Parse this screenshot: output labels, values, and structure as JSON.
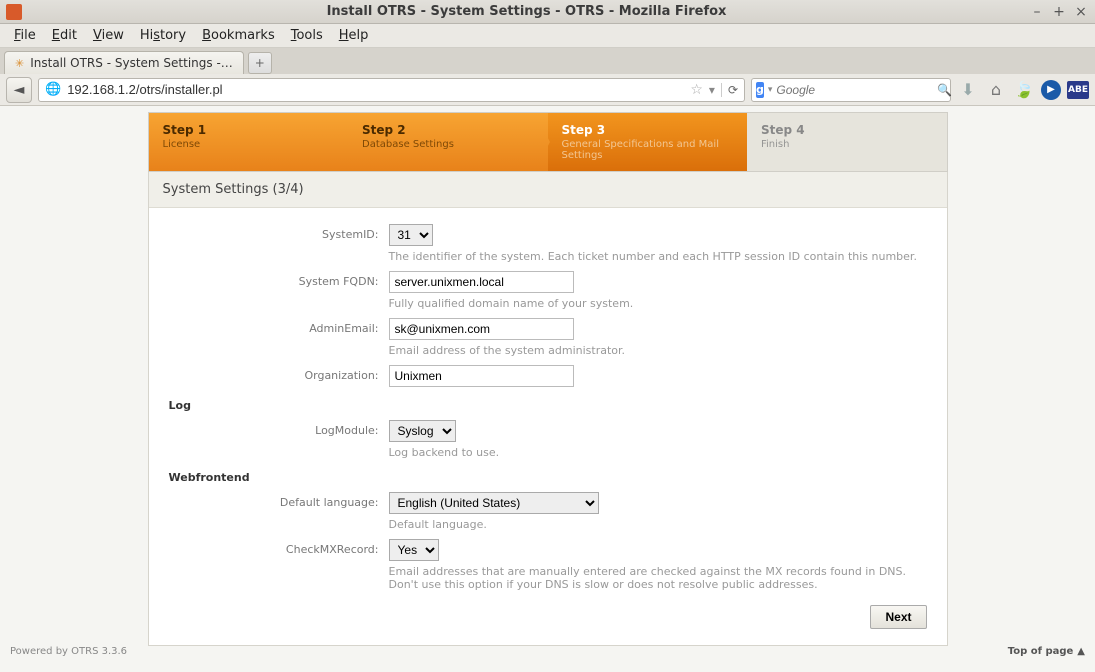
{
  "window": {
    "title": "Install OTRS - System Settings - OTRS - Mozilla Firefox"
  },
  "menu": {
    "file": "File",
    "edit": "Edit",
    "view": "View",
    "history": "History",
    "bookmarks": "Bookmarks",
    "tools": "Tools",
    "help": "Help"
  },
  "tab": {
    "label": "Install OTRS - System Settings -…"
  },
  "url": "192.168.1.2/otrs/installer.pl",
  "search": {
    "placeholder": "Google"
  },
  "steps": [
    {
      "title": "Step 1",
      "sub": "License"
    },
    {
      "title": "Step 2",
      "sub": "Database Settings"
    },
    {
      "title": "Step 3",
      "sub": "General Specifications and Mail Settings"
    },
    {
      "title": "Step 4",
      "sub": "Finish"
    }
  ],
  "panel": {
    "title": "System Settings (3/4)"
  },
  "fields": {
    "systemid": {
      "label": "SystemID:",
      "value": "31",
      "hint": "The identifier of the system. Each ticket number and each HTTP session ID contain this number."
    },
    "fqdn": {
      "label": "System FQDN:",
      "value": "server.unixmen.local",
      "hint": "Fully qualified domain name of your system."
    },
    "admin": {
      "label": "AdminEmail:",
      "value": "sk@unixmen.com",
      "hint": "Email address of the system administrator."
    },
    "org": {
      "label": "Organization:",
      "value": "Unixmen"
    },
    "logmodule": {
      "label": "LogModule:",
      "value": "Syslog",
      "hint": "Log backend to use."
    },
    "lang": {
      "label": "Default language:",
      "value": "English (United States)",
      "hint": "Default language."
    },
    "mx": {
      "label": "CheckMXRecord:",
      "value": "Yes",
      "hint": "Email addresses that are manually entered are checked against the MX records found in DNS. Don't use this option if your DNS is slow or does not resolve public addresses."
    }
  },
  "sections": {
    "log": "Log",
    "web": "Webfrontend"
  },
  "buttons": {
    "next": "Next"
  },
  "footer": {
    "powered": "Powered by OTRS 3.3.6",
    "top": "Top of page"
  }
}
